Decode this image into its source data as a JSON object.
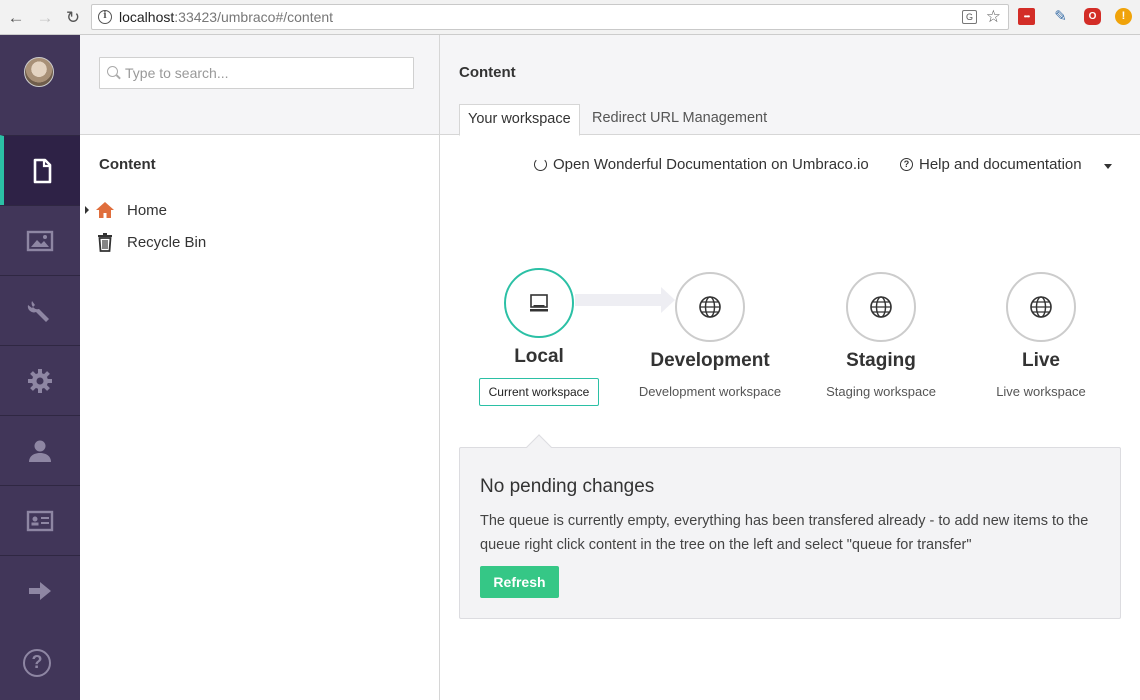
{
  "browser": {
    "url_host": "localhost",
    "url_path": ":33423/umbraco#/content"
  },
  "search": {
    "placeholder": "Type to search..."
  },
  "tree": {
    "title": "Content",
    "nodes": [
      {
        "label": "Home",
        "icon": "home-icon",
        "color": "#e06e3c"
      },
      {
        "label": "Recycle Bin",
        "icon": "trash-icon"
      }
    ]
  },
  "rail": {
    "items": [
      "content-icon",
      "media-icon",
      "developer-icon",
      "settings-icon",
      "users-icon",
      "members-icon",
      "deploy-arrow-icon"
    ],
    "help_label": "?",
    "active_color": "#2bc0a5"
  },
  "main": {
    "title": "Content",
    "tabs": [
      "Your workspace",
      "Redirect URL Management"
    ],
    "links": {
      "docs": "Open Wonderful Documentation on Umbraco.io",
      "help": "Help and documentation"
    }
  },
  "workflow": {
    "current_label": "Current workspace",
    "environments": [
      {
        "name": "Local",
        "sub": "",
        "icon": "laptop-icon"
      },
      {
        "name": "Development",
        "sub": "Development workspace",
        "icon": "globe-icon"
      },
      {
        "name": "Staging",
        "sub": "Staging workspace",
        "icon": "globe-icon"
      },
      {
        "name": "Live",
        "sub": "Live workspace",
        "icon": "globe-icon"
      }
    ]
  },
  "pending": {
    "title": "No pending changes",
    "text": "The queue is currently empty, everything has been transfered already - to add new items to the queue right click content in the tree on the left and select \"queue for transfer\"",
    "button": "Refresh",
    "button_color": "#35c786"
  }
}
